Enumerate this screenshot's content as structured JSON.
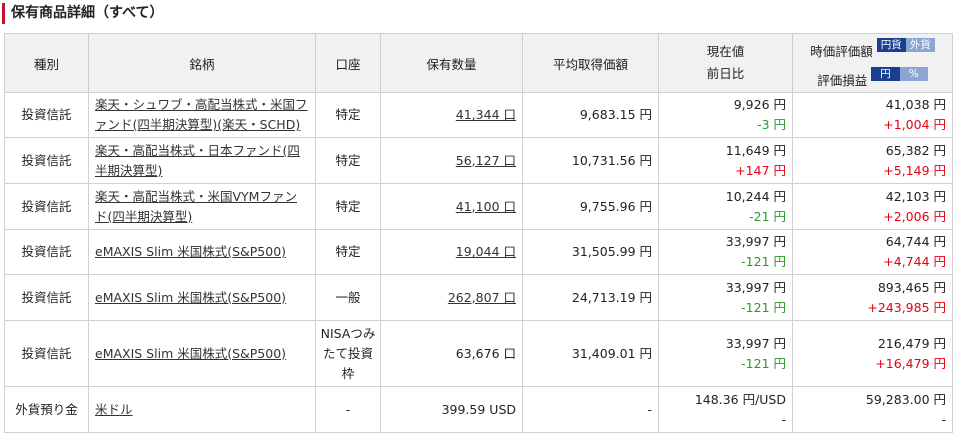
{
  "page_title": "保有商品詳細（すべて）",
  "headers": {
    "type": "種別",
    "name": "銘柄",
    "account": "口座",
    "quantity": "保有数量",
    "avg_price": "平均取得価額",
    "current_price": "現在値",
    "prev_change": "前日比",
    "market_value": "時価評価額",
    "pl": "評価損益",
    "toggle_mv_jpy": "円貨",
    "toggle_mv_fx": "外貨",
    "toggle_pl_jpy": "円",
    "toggle_pl_pct": "%"
  },
  "rows": [
    {
      "type": "投資信託",
      "name": "楽天・シュワブ・高配当株式・米国ファンド(四半期決算型)(楽天・SCHD)",
      "account": "特定",
      "quantity": "41,344 口",
      "avg_price": "9,683.15 円",
      "current_price": "9,926 円",
      "prev_change": "-3 円",
      "market_value": "41,038 円",
      "pl": "+1,004 円"
    },
    {
      "type": "投資信託",
      "name": "楽天・高配当株式・日本ファンド(四半期決算型)",
      "account": "特定",
      "quantity": "56,127 口",
      "avg_price": "10,731.56 円",
      "current_price": "11,649 円",
      "prev_change": "+147 円",
      "market_value": "65,382 円",
      "pl": "+5,149 円"
    },
    {
      "type": "投資信託",
      "name": "楽天・高配当株式・米国VYMファンド(四半期決算型)",
      "account": "特定",
      "quantity": "41,100 口",
      "avg_price": "9,755.96 円",
      "current_price": "10,244 円",
      "prev_change": "-21 円",
      "market_value": "42,103 円",
      "pl": "+2,006 円"
    },
    {
      "type": "投資信託",
      "name": "eMAXIS Slim 米国株式(S&P500)",
      "account": "特定",
      "quantity": "19,044 口",
      "avg_price": "31,505.99 円",
      "current_price": "33,997 円",
      "prev_change": "-121 円",
      "market_value": "64,744 円",
      "pl": "+4,744 円"
    },
    {
      "type": "投資信託",
      "name": "eMAXIS Slim 米国株式(S&P500)",
      "account": "一般",
      "quantity": "262,807 口",
      "avg_price": "24,713.19 円",
      "current_price": "33,997 円",
      "prev_change": "-121 円",
      "market_value": "893,465 円",
      "pl": "+243,985 円"
    },
    {
      "type": "投資信託",
      "name": "eMAXIS Slim 米国株式(S&P500)",
      "account": "NISAつみたて投資枠",
      "quantity": "63,676 口",
      "avg_price": "31,409.01 円",
      "current_price": "33,997 円",
      "prev_change": "-121 円",
      "market_value": "216,479 円",
      "pl": "+16,479 円"
    },
    {
      "type": "外貨預り金",
      "name": "米ドル",
      "account": "-",
      "quantity": "399.59 USD",
      "avg_price": "-",
      "current_price": "148.36 円/USD",
      "prev_change": "-",
      "market_value": "59,283.00 円",
      "pl": "-"
    }
  ],
  "colors": {
    "accent_red": "#c8102e",
    "positive": "#e60012",
    "negative": "#2a9a2a",
    "toggle_active": "#1a3f8f",
    "toggle_inactive": "#8ca5d4"
  }
}
